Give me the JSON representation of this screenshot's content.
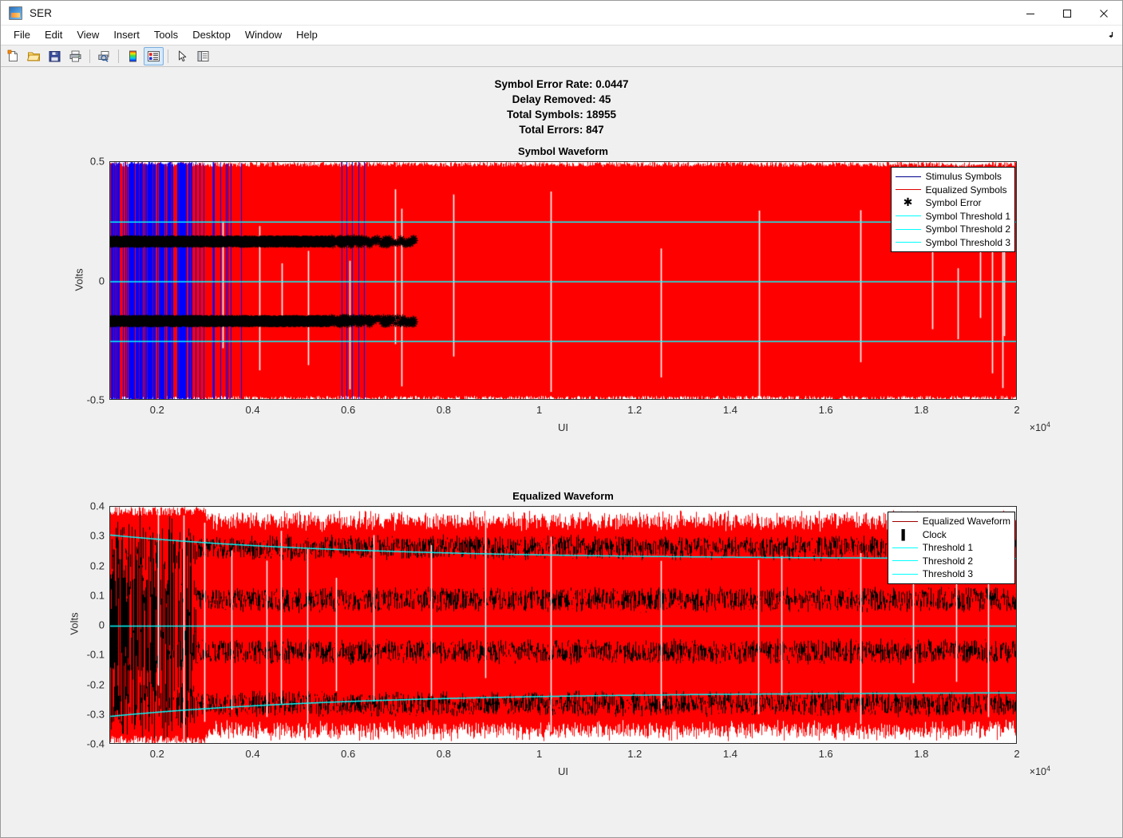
{
  "window": {
    "title": "SER",
    "app_icon": "matlab-figure-icon",
    "controls": {
      "minimize": "minimize-icon",
      "maximize": "maximize-icon",
      "close": "close-icon"
    }
  },
  "menubar": {
    "items": [
      "File",
      "Edit",
      "View",
      "Insert",
      "Tools",
      "Desktop",
      "Window",
      "Help"
    ],
    "dock_control": "dock-arrow-icon"
  },
  "toolbar": {
    "buttons": [
      {
        "name": "new-figure-icon",
        "title": "New Figure"
      },
      {
        "name": "open-file-icon",
        "title": "Open File"
      },
      {
        "name": "save-figure-icon",
        "title": "Save Figure"
      },
      {
        "name": "print-figure-icon",
        "title": "Print Figure"
      },
      {
        "name": "print-preview-icon",
        "title": "Print Preview"
      },
      {
        "name": "colorbar-icon",
        "title": "Insert Colorbar"
      },
      {
        "name": "legend-icon",
        "title": "Insert Legend",
        "active": true
      },
      {
        "name": "pointer-icon",
        "title": "Edit Plot"
      },
      {
        "name": "property-inspector-icon",
        "title": "Open Property Inspector"
      }
    ]
  },
  "figure": {
    "summary": [
      "Symbol Error Rate: 0.0447",
      "Delay Removed: 45",
      "Total Symbols: 18955",
      "Total Errors: 847"
    ]
  },
  "colors": {
    "stimulus": "#0000ff",
    "equalized": "#ff0000",
    "symbol_error": "#000000",
    "threshold": "#00ffff",
    "clock": "#000000",
    "equalized_waveform_legend": "#a00000",
    "figure_bg": "#f0f0f0",
    "axes_bg": "#ffffff"
  },
  "chart_data": [
    {
      "type": "line",
      "id": "symbol-waveform",
      "title": "Symbol Waveform",
      "xlabel": "UI",
      "ylabel": "Volts",
      "xlim": [
        1000,
        20000
      ],
      "ylim": [
        -0.5,
        0.5
      ],
      "x_exponent": "×10⁴",
      "x_exponent_value": 10000,
      "xticks": [
        2000,
        4000,
        6000,
        8000,
        10000,
        12000,
        14000,
        16000,
        18000,
        20000
      ],
      "xticklabels": [
        "0.2",
        "0.4",
        "0.6",
        "0.8",
        "1",
        "1.2",
        "1.4",
        "1.6",
        "1.8",
        "2"
      ],
      "yticks": [
        -0.5,
        0,
        0.5
      ],
      "yticklabels": [
        "-0.5",
        "0",
        "0.5"
      ],
      "grid": false,
      "legend_position": "north-east",
      "series": [
        {
          "name": "Stimulus Symbols",
          "color": "#0000ff",
          "style": "line",
          "description": "PAM-4 stimulus symbol levels spanning -0.5 to 0.5 V, visible only for UI < ~4000 where it differs from the equalized trace"
        },
        {
          "name": "Equalized Symbols",
          "color": "#ff0000",
          "style": "line",
          "description": "PAM-4 equalized symbol levels spanning -0.5 to 0.5 V across the full record, drawn over the stimulus"
        },
        {
          "name": "Symbol Error",
          "color": "#000000",
          "style": "marker",
          "marker": "asterisk",
          "description": "847 error markers plotted at +/-0.17 V, densely clustered from UI 1000 to ~5500 and thinning out beyond"
        },
        {
          "name": "Symbol Threshold 1",
          "color": "#00ffff",
          "style": "line",
          "level": 0.25
        },
        {
          "name": "Symbol Threshold 2",
          "color": "#00ffff",
          "style": "line",
          "level": 0.0
        },
        {
          "name": "Symbol Threshold 3",
          "color": "#00ffff",
          "style": "line",
          "level": -0.25
        }
      ]
    },
    {
      "type": "line",
      "id": "equalized-waveform",
      "title": "Equalized Waveform",
      "xlabel": "UI",
      "ylabel": "Volts",
      "xlim": [
        1000,
        20000
      ],
      "ylim": [
        -0.4,
        0.4
      ],
      "x_exponent": "×10⁴",
      "x_exponent_value": 10000,
      "xticks": [
        2000,
        4000,
        6000,
        8000,
        10000,
        12000,
        14000,
        16000,
        18000,
        20000
      ],
      "xticklabels": [
        "0.2",
        "0.4",
        "0.6",
        "0.8",
        "1",
        "1.2",
        "1.4",
        "1.6",
        "1.8",
        "2"
      ],
      "yticks": [
        -0.4,
        -0.3,
        -0.2,
        -0.1,
        0,
        0.1,
        0.2,
        0.3,
        0.4
      ],
      "yticklabels": [
        "-0.4",
        "-0.3",
        "-0.2",
        "-0.1",
        "0",
        "0.1",
        "0.2",
        "0.3",
        "0.4"
      ],
      "grid": false,
      "legend_position": "north-east",
      "series": [
        {
          "name": "Equalized Waveform",
          "color": "#ff0000",
          "legend_color": "#a00000",
          "style": "line",
          "description": "Dense PAM-4 equalized waveform, four level bands near +/-0.26 and +/-0.085 V with noise envelope reaching +/-0.4 V"
        },
        {
          "name": "Clock",
          "color": "#000000",
          "style": "marker",
          "marker": "vertical-tick",
          "description": "Clock sample ticks overlaid on the waveform, appearing as black banding at the four PAM level bands"
        },
        {
          "name": "Threshold 1",
          "color": "#00ffff",
          "style": "line",
          "description": "Adaptive upper threshold decaying from 0.305 V at UI 1000 toward ~0.225 V by UI 6000, then flat"
        },
        {
          "name": "Threshold 2",
          "color": "#00ffff",
          "style": "line",
          "level": 0.0,
          "description": "Mid threshold held flat at 0 V"
        },
        {
          "name": "Threshold 3",
          "color": "#00ffff",
          "style": "line",
          "description": "Adaptive lower threshold rising from -0.305 V at UI 1000 toward ~-0.225 V by UI 6000, then flat"
        }
      ]
    }
  ]
}
